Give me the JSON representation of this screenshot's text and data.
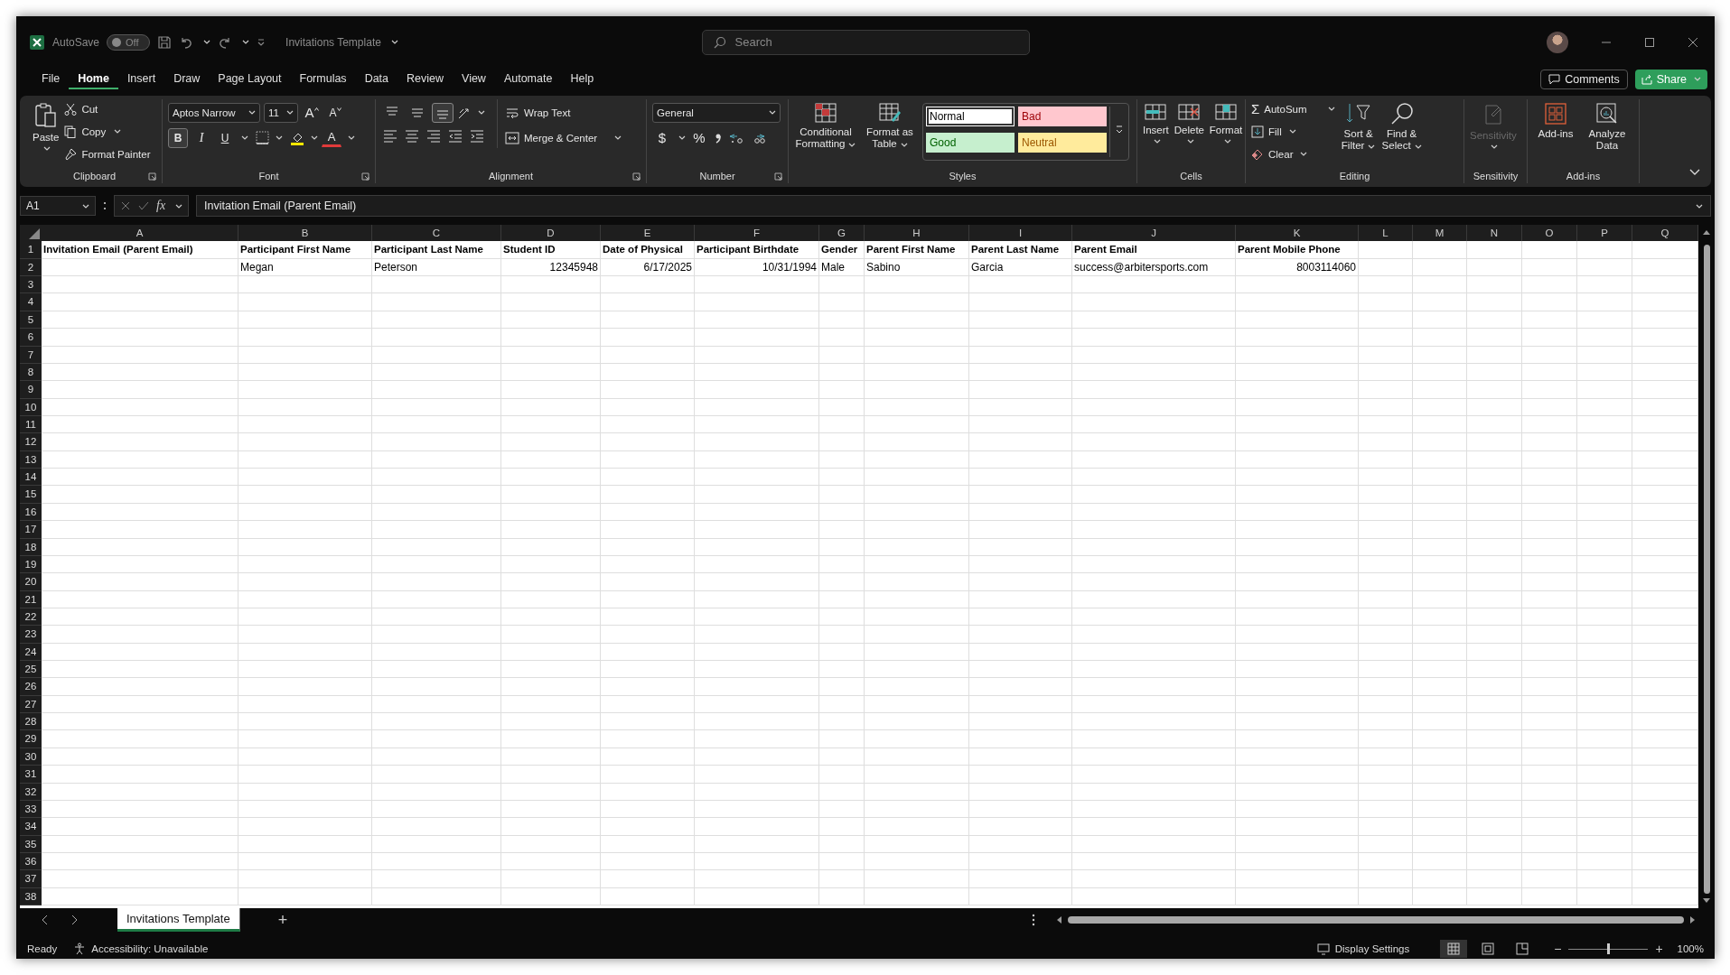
{
  "title_bar": {
    "autosave_label": "AutoSave",
    "autosave": {
      "label": "Off",
      "on": false
    },
    "document_title": "Invitations Template",
    "search": {
      "placeholder": "Search"
    }
  },
  "menu_tabs": [
    {
      "label": "File",
      "selected": false
    },
    {
      "label": "Home",
      "selected": true
    },
    {
      "label": "Insert",
      "selected": false
    },
    {
      "label": "Draw",
      "selected": false
    },
    {
      "label": "Page Layout",
      "selected": false
    },
    {
      "label": "Formulas",
      "selected": false
    },
    {
      "label": "Data",
      "selected": false
    },
    {
      "label": "Review",
      "selected": false
    },
    {
      "label": "View",
      "selected": false
    },
    {
      "label": "Automate",
      "selected": false
    },
    {
      "label": "Help",
      "selected": false
    }
  ],
  "header_buttons": {
    "comments": "Comments",
    "share": "Share"
  },
  "ribbon": {
    "clipboard": {
      "label": "Clipboard",
      "paste": "Paste",
      "cut": "Cut",
      "copy": "Copy",
      "format_painter": "Format Painter"
    },
    "font": {
      "label": "Font",
      "font_name": "Aptos Narrow",
      "font_size": "11",
      "grow": "A",
      "shrink": "A",
      "bold": {
        "label": "B",
        "on": true
      },
      "italic": {
        "label": "I",
        "on": false
      },
      "underline": {
        "label": "U",
        "on": false
      },
      "font_color": "A"
    },
    "alignment": {
      "label": "Alignment",
      "vertical_align": [
        {
          "selected": false
        },
        {
          "selected": false
        },
        {
          "selected": true
        }
      ],
      "wrap_text": "Wrap Text",
      "merge_center": "Merge & Center"
    },
    "number": {
      "label": "Number",
      "format": "General",
      "currency": "$",
      "percent": "%"
    },
    "styles": {
      "label": "Styles",
      "conditional_formatting": "Conditional Formatting",
      "format_as_table": "Format as Table",
      "cell_styles": [
        {
          "label": "Normal",
          "color": "#ffffff"
        },
        {
          "label": "Bad",
          "color": "#ffc7ce"
        },
        {
          "label": "Good",
          "color": "#c6efce"
        },
        {
          "label": "Neutral",
          "color": "#ffeb9c"
        }
      ]
    },
    "cells": {
      "label": "Cells",
      "buttons": [
        "Insert",
        "Delete",
        "Format"
      ]
    },
    "editing": {
      "label": "Editing",
      "autosum": "AutoSum",
      "sigma": "Σ",
      "fill": "Fill",
      "clear": "Clear",
      "sort_filter": "Sort & Filter",
      "find_select": "Find & Select"
    },
    "sensitivity": {
      "label": "Sensitivity",
      "button": {
        "label": "Sensitivity",
        "disabled": true
      }
    },
    "addins": {
      "label": "Add-ins",
      "buttons": [
        "Add-ins",
        "Analyze Data"
      ]
    }
  },
  "formula_bar": {
    "name_box": "A1",
    "function_label": "fx",
    "formula": "Invitation Email (Parent Email)"
  },
  "sheet": {
    "columns": [
      "A",
      "B",
      "C",
      "D",
      "E",
      "F",
      "G",
      "H",
      "I",
      "J",
      "K",
      "L",
      "M",
      "N",
      "O",
      "P",
      "Q"
    ],
    "rows": [
      {
        "number": "1",
        "bold": true,
        "cells": {
          "A": {
            "text": "Invitation Email (Parent Email)",
            "kind": "text"
          },
          "B": {
            "text": "Participant First Name",
            "kind": "text"
          },
          "C": {
            "text": "Participant Last Name",
            "kind": "text"
          },
          "D": {
            "text": "Student ID",
            "kind": "text"
          },
          "E": {
            "text": "Date of Physical",
            "kind": "text"
          },
          "F": {
            "text": "Participant Birthdate",
            "kind": "text"
          },
          "G": {
            "text": "Gender",
            "kind": "text"
          },
          "H": {
            "text": "Parent First Name",
            "kind": "text"
          },
          "I": {
            "text": "Parent Last Name",
            "kind": "text"
          },
          "J": {
            "text": "Parent Email",
            "kind": "text"
          },
          "K": {
            "text": "Parent Mobile Phone",
            "kind": "text"
          }
        }
      },
      {
        "number": "2",
        "bold": false,
        "cells": {
          "B": {
            "text": "Megan",
            "kind": "text"
          },
          "C": {
            "text": "Peterson",
            "kind": "text"
          },
          "D": {
            "text": "12345948",
            "kind": "number"
          },
          "E": {
            "text": "6/17/2025",
            "kind": "number"
          },
          "F": {
            "text": "10/31/1994",
            "kind": "number"
          },
          "G": {
            "text": "Male",
            "kind": "text"
          },
          "H": {
            "text": "Sabino",
            "kind": "text"
          },
          "I": {
            "text": "Garcia",
            "kind": "text"
          },
          "J": {
            "text": "success@arbitersports.com",
            "kind": "text"
          },
          "K": {
            "text": "8003114060",
            "kind": "number"
          }
        }
      },
      {
        "number": "3"
      },
      {
        "number": "4"
      },
      {
        "number": "5"
      },
      {
        "number": "6"
      },
      {
        "number": "7"
      },
      {
        "number": "8"
      },
      {
        "number": "9"
      },
      {
        "number": "10"
      },
      {
        "number": "11"
      },
      {
        "number": "12"
      },
      {
        "number": "13"
      },
      {
        "number": "14"
      },
      {
        "number": "15"
      },
      {
        "number": "16"
      },
      {
        "number": "17"
      },
      {
        "number": "18"
      },
      {
        "number": "19"
      },
      {
        "number": "20"
      },
      {
        "number": "21"
      },
      {
        "number": "22"
      },
      {
        "number": "23"
      },
      {
        "number": "24"
      },
      {
        "number": "25"
      },
      {
        "number": "26"
      },
      {
        "number": "27"
      },
      {
        "number": "28"
      },
      {
        "number": "29"
      },
      {
        "number": "30"
      },
      {
        "number": "31"
      },
      {
        "number": "32"
      },
      {
        "number": "33"
      },
      {
        "number": "34"
      },
      {
        "number": "35"
      },
      {
        "number": "36"
      },
      {
        "number": "37"
      },
      {
        "number": "38"
      }
    ]
  },
  "sheet_tabs": [
    {
      "label": "Invitations Template",
      "selected": true
    }
  ],
  "new_sheet": "+",
  "status_bar": {
    "mode": "Ready",
    "accessibility": "Accessibility: Unavailable",
    "display_settings": "Display Settings",
    "views": [
      {
        "selected": true
      },
      {
        "selected": false
      },
      {
        "selected": false
      }
    ],
    "zoom_out": "−",
    "zoom_in": "+",
    "zoom": {
      "level": 0.48,
      "reading": "100%"
    }
  }
}
